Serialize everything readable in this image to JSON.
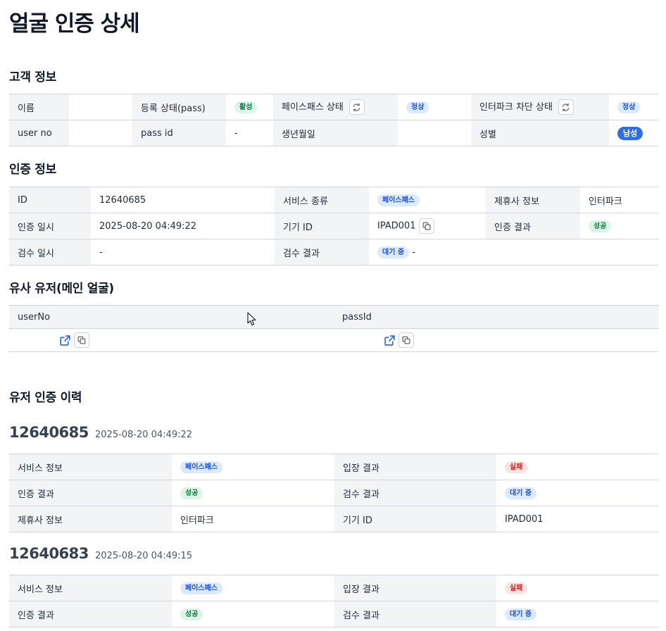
{
  "page_title": "얼굴 인증 상세",
  "customer": {
    "title": "고객 정보",
    "name_label": "이름",
    "name_value": "",
    "reg_status_label": "등록 상태(pass)",
    "reg_status_badge": "활성",
    "facepass_status_label": "페이스패스 상태",
    "facepass_status_badge": "정상",
    "interpark_block_label": "인터파크 차단 상태",
    "interpark_block_badge": "정상",
    "user_no_label": "user no",
    "user_no_value": "",
    "pass_id_label": "pass id",
    "pass_id_value": "-",
    "birth_label": "생년월일",
    "birth_value": "",
    "gender_label": "성별",
    "gender_badge": "남성"
  },
  "auth": {
    "title": "인증 정보",
    "id_label": "ID",
    "id_value": "12640685",
    "service_label": "서비스 종류",
    "service_badge": "페이스패스",
    "partner_label": "제휴사 정보",
    "partner_value": "인터파크",
    "date_label": "인증 일시",
    "date_value": "2025-08-20 04:49:22",
    "device_label": "기기 ID",
    "device_value": "IPAD001",
    "result_label": "인증 결과",
    "result_badge": "성공",
    "review_date_label": "검수 일시",
    "review_date_value": "-",
    "review_result_label": "검수 결과",
    "review_result_badge": "대기 중",
    "review_result_suffix": "-"
  },
  "similar": {
    "title": "유사 유저(메인 얼굴)",
    "col_user_no": "userNo",
    "col_pass_id": "passId"
  },
  "history": {
    "title": "유저 인증 이력",
    "entries": [
      {
        "id": "12640685",
        "time": "2025-08-20 04:49:22",
        "service_label": "서비스 정보",
        "service_badge": "페이스패스",
        "entry_label": "입장 결과",
        "entry_badge": "실패",
        "auth_label": "인증 결과",
        "auth_badge": "성공",
        "review_label": "검수 결과",
        "review_badge": "대기 중",
        "partner_label": "제휴사 정보",
        "partner_value": "인터파크",
        "device_label": "기기 ID",
        "device_value": "IPAD001"
      },
      {
        "id": "12640683",
        "time": "2025-08-20 04:49:15",
        "service_label": "서비스 정보",
        "service_badge": "페이스패스",
        "entry_label": "입장 결과",
        "entry_badge": "실패",
        "auth_label": "인증 결과",
        "auth_badge": "성공",
        "review_label": "검수 결과",
        "review_badge": "대기 중"
      }
    ]
  },
  "colors": {
    "label_bg": "#f3f4f6",
    "border": "#d1d5db",
    "success": "#0f7a43",
    "info": "#1d4ed8",
    "danger": "#c81e1e",
    "link": "#2f6fe0"
  }
}
